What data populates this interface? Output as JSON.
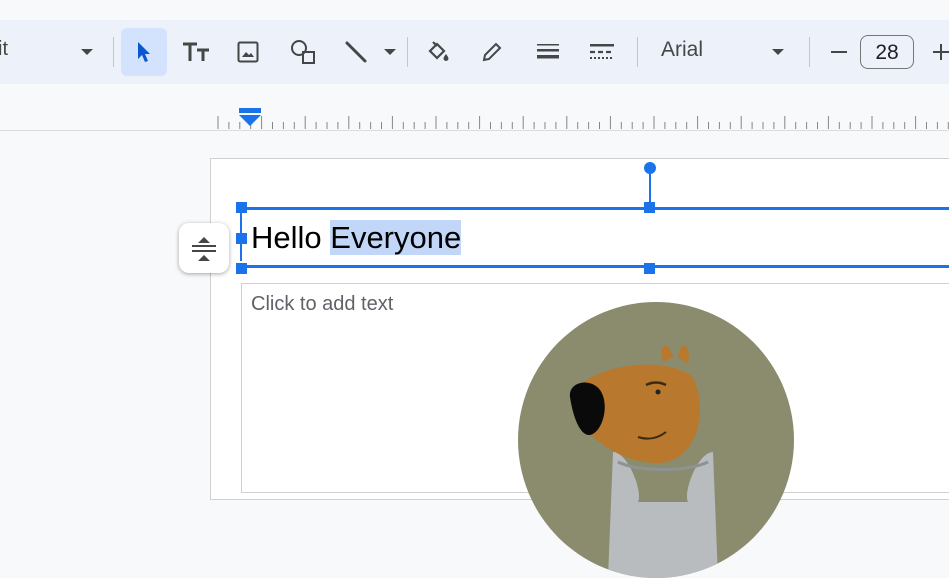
{
  "toolbar": {
    "layout_label": "it",
    "select_tool": "select-arrow",
    "font": {
      "name": "Arial"
    },
    "font_size": {
      "decrease": "–",
      "value": "28",
      "increase": "+"
    }
  },
  "slide": {
    "title": {
      "text_plain": "Hello ",
      "text_selected": "Everyone"
    },
    "body": {
      "placeholder": "Click to add text"
    }
  },
  "colors": {
    "accent": "#1a73e8",
    "toolbar_bg": "#edf2fa",
    "selection": "#c2d7f7",
    "avatar_bg": "#8a8c6d"
  }
}
